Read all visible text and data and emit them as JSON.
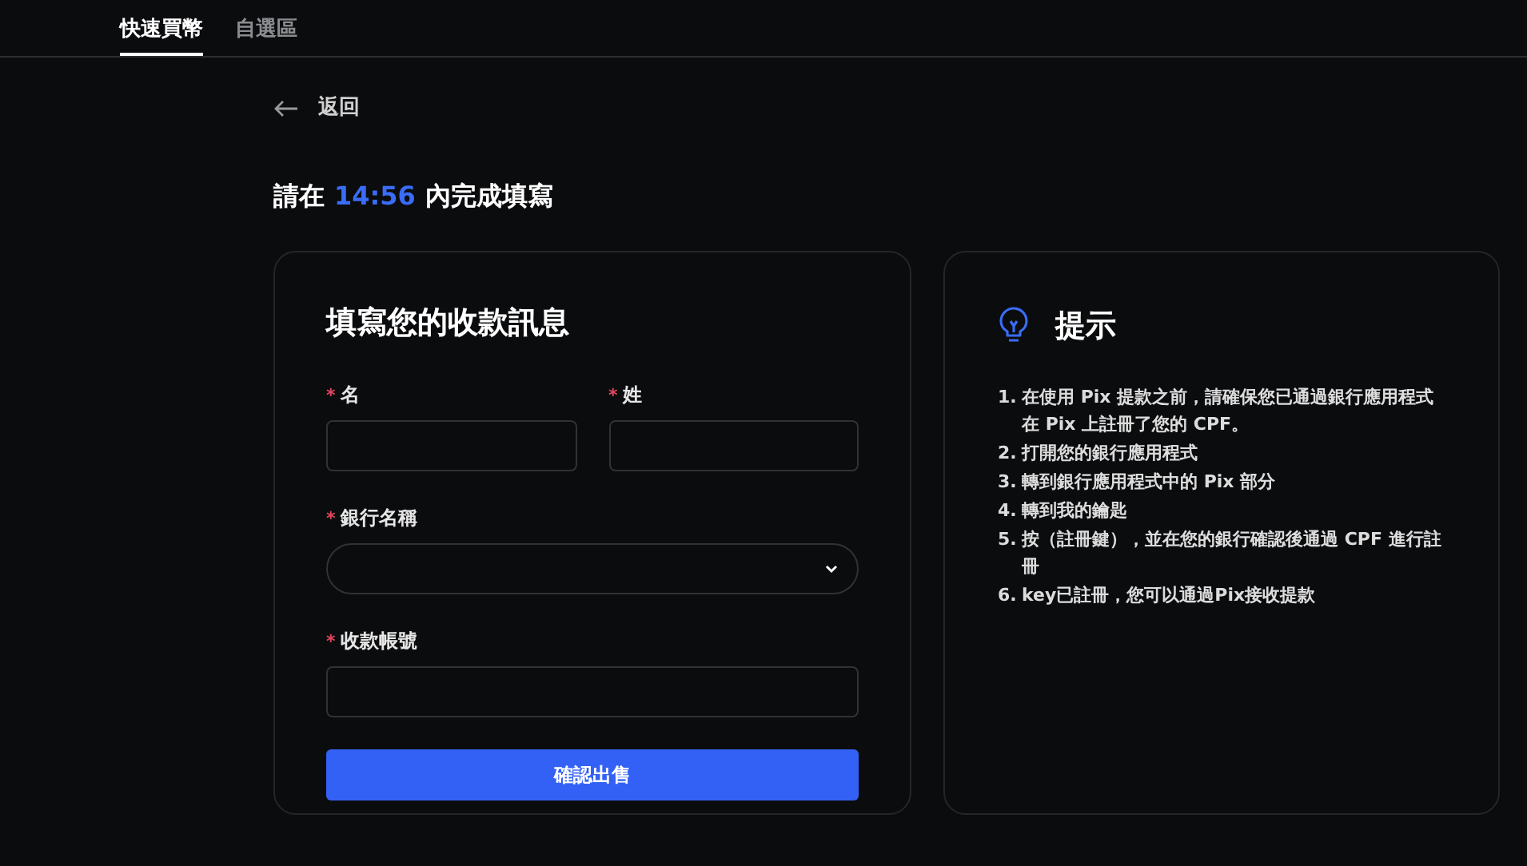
{
  "tabs": [
    {
      "label": "快速買幣",
      "selected": true
    },
    {
      "label": "自選區",
      "selected": false
    }
  ],
  "back": {
    "label": "返回"
  },
  "deadline": {
    "prefix": "請在",
    "time": "14:56",
    "suffix": "內完成填寫"
  },
  "form": {
    "title": "填寫您的收款訊息",
    "rows": [
      [
        {
          "kind": "text",
          "label": "名",
          "mark": "*"
        },
        {
          "kind": "text",
          "label": "姓",
          "mark": "*"
        }
      ],
      [
        {
          "kind": "select",
          "label": "銀行名稱",
          "mark": "*"
        }
      ],
      [
        {
          "kind": "text",
          "label": "收款帳號",
          "mark": "*"
        }
      ]
    ],
    "submit": "確認出售"
  },
  "tips": {
    "title": "提示",
    "items": [
      {
        "number": "1.",
        "text": "在使用 Pix 提款之前，請確保您已通過銀行應用程式在 Pix 上註冊了您的 CPF。"
      },
      {
        "number": "2.",
        "text": "打開您的銀行應用程式"
      },
      {
        "number": "3.",
        "text": "轉到銀行應用程式中的 Pix 部分"
      },
      {
        "number": "4.",
        "text": "轉到我的鑰匙"
      },
      {
        "number": "5.",
        "text": "按（註冊鍵），並在您的銀行確認後通過 CPF 進行註冊"
      },
      {
        "number": "6.",
        "text": "key已註冊，您可以通過Pix接收提款"
      }
    ]
  }
}
